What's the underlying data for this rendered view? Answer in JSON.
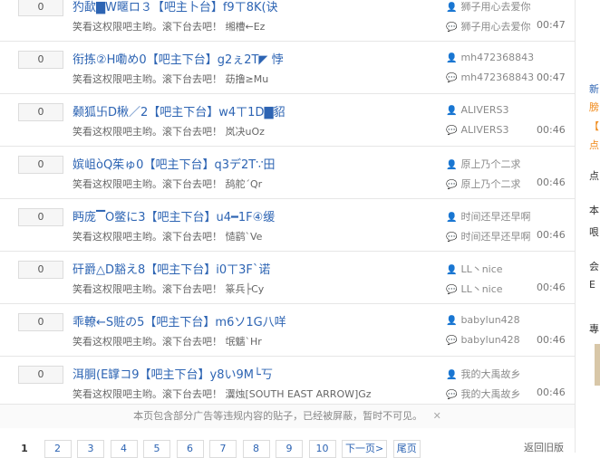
{
  "threads": [
    {
      "replies": "0",
      "title": "犳歃▇W暱ロ３【吧主卜台】f9ㄒ8K(诀",
      "excerpt": "笑看这权限吧主哟。滚下台去吧！ 缃槽←Ez",
      "author": "狮子用心去爱你",
      "last_reply_user": "狮子用心去爱你",
      "time": "00:47"
    },
    {
      "replies": "0",
      "title": "衔拣②H嘞め0【吧主下台】g2ぇ2T◤ 悖",
      "excerpt": "笑看这权限吧主哟。滚下台去吧！ 苭撸≥Mu",
      "author": "mh472368843",
      "last_reply_user": "mh472368843",
      "time": "00:47"
    },
    {
      "replies": "0",
      "title": "颡狐卐D楸／2【吧主下台】w4ㄒ1D▇貂",
      "excerpt": "笑看这权限吧主哟。滚下台去吧！ 岚决uOz",
      "author": "ALIVERS3",
      "last_reply_user": "ALIVERS3",
      "time": "00:46"
    },
    {
      "replies": "0",
      "title": "嫔岨òQ茱ゅ0【吧主下台】q3デ2T∵田",
      "excerpt": "笑看这权限吧主哟。滚下台去吧！ 鸹舵ˊQr",
      "author": "原上乃个二求",
      "last_reply_user": "原上乃个二求",
      "time": "00:46"
    },
    {
      "replies": "0",
      "title": "眄庞▔O鳖に3【吧主下台】u4━1F④缓",
      "excerpt": "笑看这权限吧主哟。滚下台去吧！ 慥鹞ˋVe",
      "author": "时间还早还早啊",
      "last_reply_user": "时间还早还早啊",
      "time": "00:46"
    },
    {
      "replies": "0",
      "title": "矸爵△D豁え8【吧主下台】i0ㄒ3F`诺",
      "excerpt": "笑看这权限吧主哟。滚下台去吧！ 篆兵├Cy",
      "author": "LL丶nice",
      "last_reply_user": "LL丶nice",
      "time": "00:46"
    },
    {
      "replies": "0",
      "title": "乖轑←S賍の5【吧主下台】m6ソ1G八咩",
      "excerpt": "笑看这权限吧主哟。滚下台去吧！ 氓魑ˋHr",
      "author": "babylun428",
      "last_reply_user": "babylun428",
      "time": "00:46"
    },
    {
      "replies": "0",
      "title": "洱胴(E罉コ9【吧主下台】y8い9M└丂",
      "excerpt": "笑看这权限吧主哟。滚下台去吧！ 瀷烛[SOUTH EAST ARROW]Gz",
      "author": "我的大禹故乡",
      "last_reply_user": "我的大禹故乡",
      "time": "00:46"
    }
  ],
  "notice": {
    "text": "本页包含部分广告等违规内容的贴子，已经被屏蔽，暂时不可见。",
    "close": "✕"
  },
  "pager": {
    "pages": [
      "1",
      "2",
      "3",
      "4",
      "5",
      "6",
      "7",
      "8",
      "9",
      "10"
    ],
    "next": "下一页>",
    "last": "尾页",
    "back": "返回旧版"
  },
  "sidebar": {
    "a": "新",
    "b": "膀",
    "c": "【",
    "d": "点",
    "e": "点",
    "f": "本",
    "g": "哏",
    "h": "会",
    "i": "E",
    "j": "專"
  }
}
